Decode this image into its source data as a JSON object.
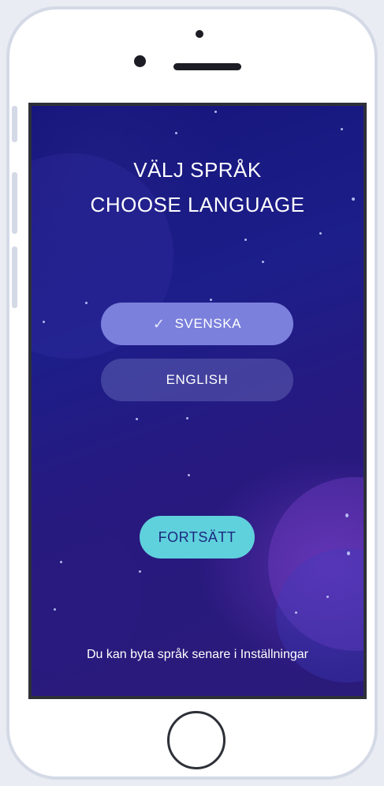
{
  "screen": {
    "title_swedish": "VÄLJ SPRÅK",
    "title_english": "CHOOSE LANGUAGE",
    "languages": [
      {
        "label": "SVENSKA",
        "selected": true
      },
      {
        "label": "ENGLISH",
        "selected": false
      }
    ],
    "check_glyph": "✓",
    "continue_label": "FORTSÄTT",
    "footnote": "Du kan byta språk senare i Inställningar"
  },
  "colors": {
    "background_top": "#15147a",
    "background_bottom": "#2a1a7a",
    "selected_button": "#7b80dc",
    "unselected_button": "#5f63b0",
    "continue_button": "#5fd1dc",
    "continue_text": "#1b2980",
    "text": "#ffffff"
  },
  "device": {
    "frame_color": "#ffffff",
    "frame_border": "#d4d9e6"
  }
}
